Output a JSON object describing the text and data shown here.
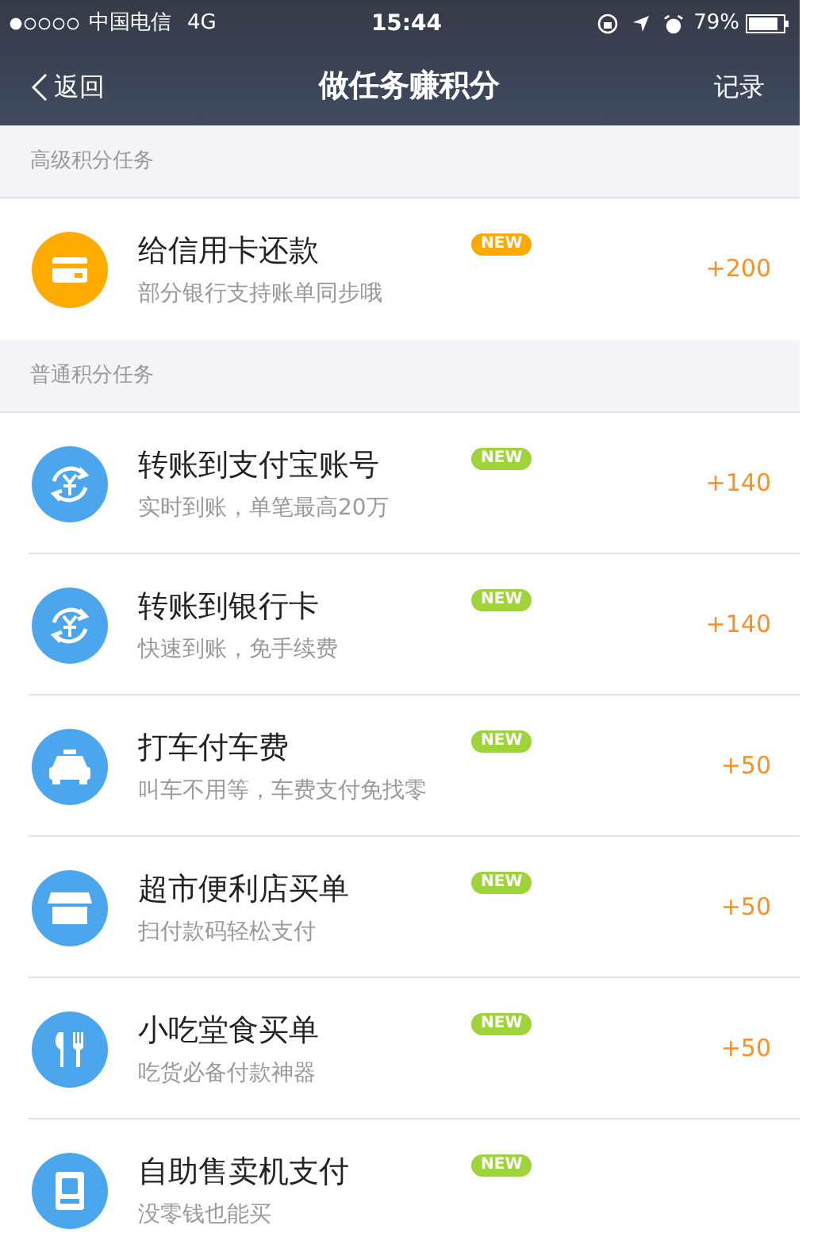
{
  "status_bar": {
    "carrier": "中国电信",
    "network": "4G",
    "time": "15:44",
    "battery": "79%"
  },
  "nav": {
    "back": "返回",
    "title": "做任务赚积分",
    "action": "记录"
  },
  "sections": [
    {
      "title": "高级积分任务",
      "tasks": [
        {
          "title": "给信用卡还款",
          "subtitle": "部分银行支持账单同步哦",
          "badge": {
            "text": "NEW",
            "color": "#ffa800"
          },
          "icon": {
            "kind": "card",
            "color": "#ffab00"
          },
          "points": "+200"
        }
      ]
    },
    {
      "title": "普通积分任务",
      "tasks": [
        {
          "title": "转账到支付宝账号",
          "subtitle": "实时到账，单笔最高20万",
          "badge": {
            "text": "NEW",
            "color": "#9ed33a"
          },
          "icon": {
            "kind": "transfer",
            "color": "#4ba6ee"
          },
          "points": "+140"
        },
        {
          "title": "转账到银行卡",
          "subtitle": "快速到账，免手续费",
          "badge": {
            "text": "NEW",
            "color": "#9ed33a"
          },
          "icon": {
            "kind": "transfer",
            "color": "#4ba6ee"
          },
          "points": "+140"
        },
        {
          "title": "打车付车费",
          "subtitle": "叫车不用等，车费支付免找零",
          "badge": {
            "text": "NEW",
            "color": "#9ed33a"
          },
          "icon": {
            "kind": "taxi",
            "color": "#4ba6ee"
          },
          "points": "+50"
        },
        {
          "title": "超市便利店买单",
          "subtitle": "扫付款码轻松支付",
          "badge": {
            "text": "NEW",
            "color": "#9ed33a"
          },
          "icon": {
            "kind": "store",
            "color": "#4ba6ee"
          },
          "points": "+50"
        },
        {
          "title": "小吃堂食买单",
          "subtitle": "吃货必备付款神器",
          "badge": {
            "text": "NEW",
            "color": "#9ed33a"
          },
          "icon": {
            "kind": "food",
            "color": "#4ba6ee"
          },
          "points": "+50"
        },
        {
          "title": "自助售卖机支付",
          "subtitle": "没零钱也能买",
          "badge": {
            "text": "NEW",
            "color": "#9ed33a"
          },
          "icon": {
            "kind": "vending",
            "color": "#4ba6ee"
          }
        }
      ]
    }
  ]
}
